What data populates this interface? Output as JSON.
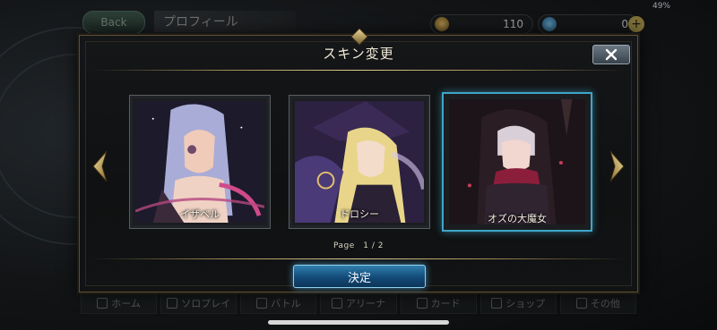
{
  "status": {
    "battery": "49%"
  },
  "header": {
    "back_label": "Back",
    "title": "プロフィール"
  },
  "currency": {
    "gold": "110",
    "gems": "0",
    "plus": "+"
  },
  "modal": {
    "title": "スキン変更",
    "close_icon": "close-x-icon",
    "skins": [
      {
        "name": "イザベル",
        "selected": false
      },
      {
        "name": "ドロシー",
        "selected": false
      },
      {
        "name": "オズの大魔女",
        "selected": true
      }
    ],
    "pager": "Page　1 / 2",
    "confirm_label": "決定"
  },
  "bottom_nav": [
    {
      "label": "ホーム"
    },
    {
      "label": "ソロプレイ"
    },
    {
      "label": "バトル"
    },
    {
      "label": "アリーナ"
    },
    {
      "label": "カード"
    },
    {
      "label": "ショップ"
    },
    {
      "label": "その他"
    }
  ],
  "colors": {
    "accent_blue": "#3fa6c8",
    "gold_line": "#e0cc8e",
    "confirm_blue": "#2f7fae"
  }
}
